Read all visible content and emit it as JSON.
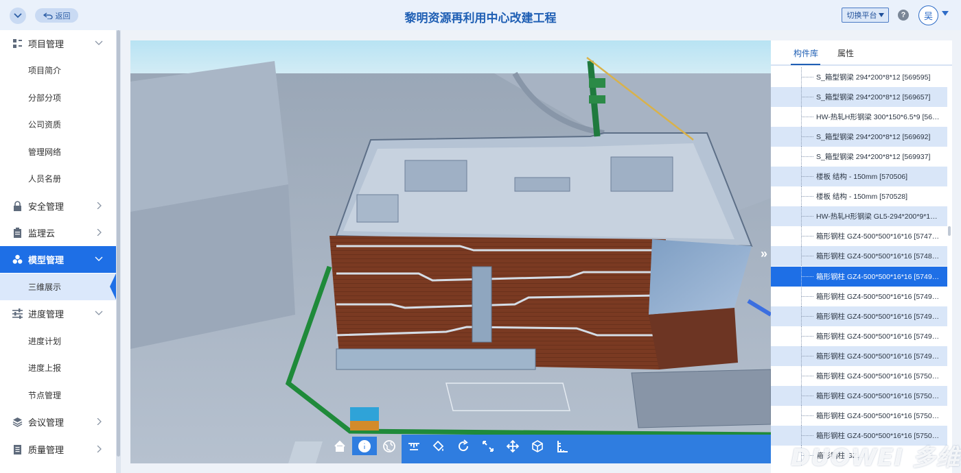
{
  "header": {
    "back_label": "返回",
    "title": "黎明资源再利用中心改建工程",
    "platform_label": "切换平台",
    "help_label": "?",
    "avatar_label": "吴"
  },
  "sidebar": {
    "items": [
      {
        "label": "项目管理",
        "icon": "project-icon",
        "type": "group",
        "expanded": true
      },
      {
        "label": "项目简介",
        "type": "sub"
      },
      {
        "label": "分部分项",
        "type": "sub"
      },
      {
        "label": "公司资质",
        "type": "sub"
      },
      {
        "label": "管理网络",
        "type": "sub"
      },
      {
        "label": "人员名册",
        "type": "sub"
      },
      {
        "label": "安全管理",
        "icon": "lock-icon",
        "type": "group",
        "expanded": false
      },
      {
        "label": "监理云",
        "icon": "clipboard-icon",
        "type": "group",
        "expanded": false
      },
      {
        "label": "模型管理",
        "icon": "cubes-icon",
        "type": "group",
        "expanded": true,
        "active": true
      },
      {
        "label": "三维展示",
        "type": "sub",
        "active": true
      },
      {
        "label": "进度管理",
        "icon": "sliders-icon",
        "type": "group",
        "expanded": true
      },
      {
        "label": "进度计划",
        "type": "sub"
      },
      {
        "label": "进度上报",
        "type": "sub"
      },
      {
        "label": "节点管理",
        "type": "sub"
      },
      {
        "label": "会议管理",
        "icon": "layers-icon",
        "type": "group",
        "expanded": false
      },
      {
        "label": "质量管理",
        "icon": "document-icon",
        "type": "group",
        "expanded": false
      }
    ]
  },
  "panel": {
    "tabs": [
      "构件库",
      "属性"
    ],
    "active_tab": 0,
    "rows": [
      "S_箱型钢梁 294*200*8*12 [569595]",
      "S_箱型钢梁 294*200*8*12 [569657]",
      "HW-热轧H形钢梁 300*150*6.5*9 [56…",
      "S_箱型钢梁 294*200*8*12 [569692]",
      "S_箱型钢梁 294*200*8*12 [569937]",
      "楼板 结构 - 150mm [570506]",
      "楼板 结构 - 150mm [570528]",
      "HW-热轧H形钢梁 GL5-294*200*9*1…",
      "箱形钢柱 GZ4-500*500*16*16 [5747…",
      "箱形钢柱 GZ4-500*500*16*16 [5748…",
      "箱形钢柱 GZ4-500*500*16*16 [5749…",
      "箱形钢柱 GZ4-500*500*16*16 [5749…",
      "箱形钢柱 GZ4-500*500*16*16 [5749…",
      "箱形钢柱 GZ4-500*500*16*16 [5749…",
      "箱形钢柱 GZ4-500*500*16*16 [5749…",
      "箱形钢柱 GZ4-500*500*16*16 [5750…",
      "箱形钢柱 GZ4-500*500*16*16 [5750…",
      "箱形钢柱 GZ4-500*500*16*16 [5750…",
      "箱形钢柱 GZ4-500*500*16*16 [5750…",
      "箱形钢柱 GZ..."
    ],
    "selected_row": 10
  },
  "viewer": {
    "toolbar": [
      "home-icon",
      "info-icon",
      "globe-icon",
      "measure-icon",
      "paint-icon",
      "rotate-icon",
      "fullscreen-icon",
      "move-icon",
      "cube-icon",
      "section-icon"
    ],
    "toolbar_active": [
      1,
      5
    ]
  },
  "watermark": "DUOWEI 多维",
  "colors": {
    "accent": "#1e6fe6",
    "title": "#1f5fb4",
    "row_alt": "#d9e6f8"
  }
}
